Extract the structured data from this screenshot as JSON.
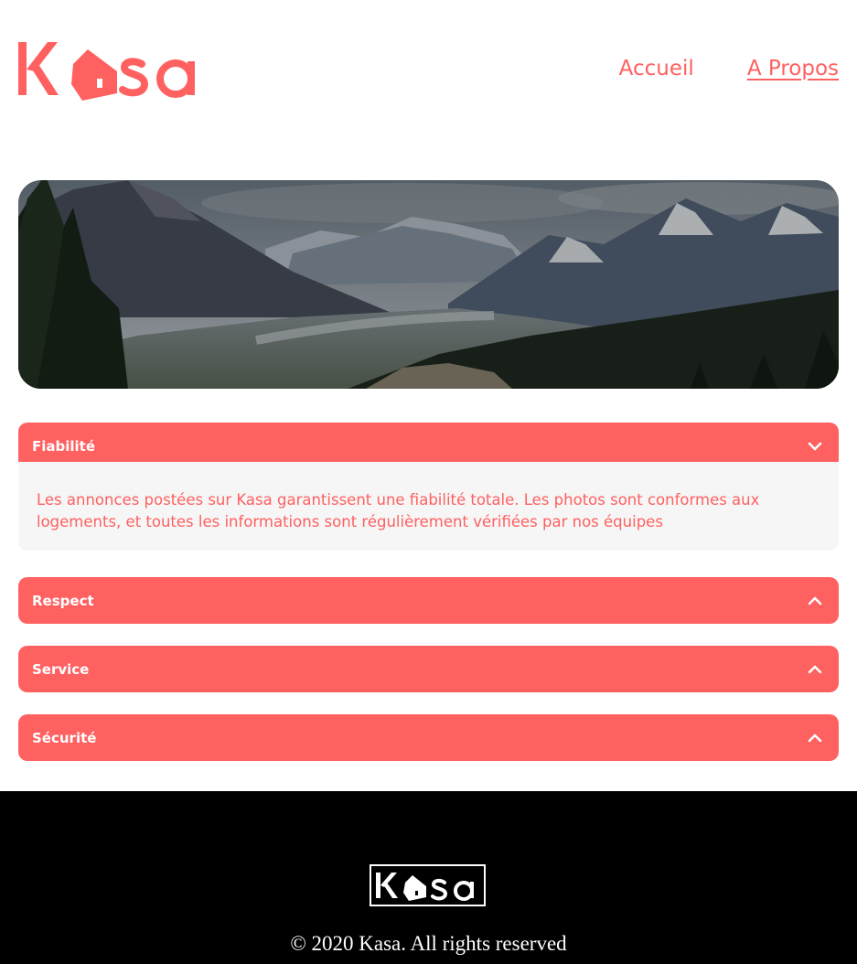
{
  "brand": {
    "name": "Kasa",
    "color": "#FF6060"
  },
  "nav": {
    "items": [
      {
        "label": "Accueil",
        "active": false
      },
      {
        "label": "A Propos",
        "active": true
      }
    ]
  },
  "banner": {
    "description_icon": "mountain-landscape-image"
  },
  "collapses": [
    {
      "title": "Fiabilité",
      "open": true,
      "icon": "chevron-down-icon",
      "body": "Les annonces postées sur Kasa garantissent une fiabilité totale. Les photos sont conformes aux logements, et toutes les informations sont régulièrement vérifiées par nos équipes"
    },
    {
      "title": "Respect",
      "open": false,
      "icon": "chevron-up-icon"
    },
    {
      "title": "Service",
      "open": false,
      "icon": "chevron-up-icon"
    },
    {
      "title": "Sécurité",
      "open": false,
      "icon": "chevron-up-icon"
    }
  ],
  "footer": {
    "copyright": "© 2020 Kasa. All rights reserved"
  }
}
